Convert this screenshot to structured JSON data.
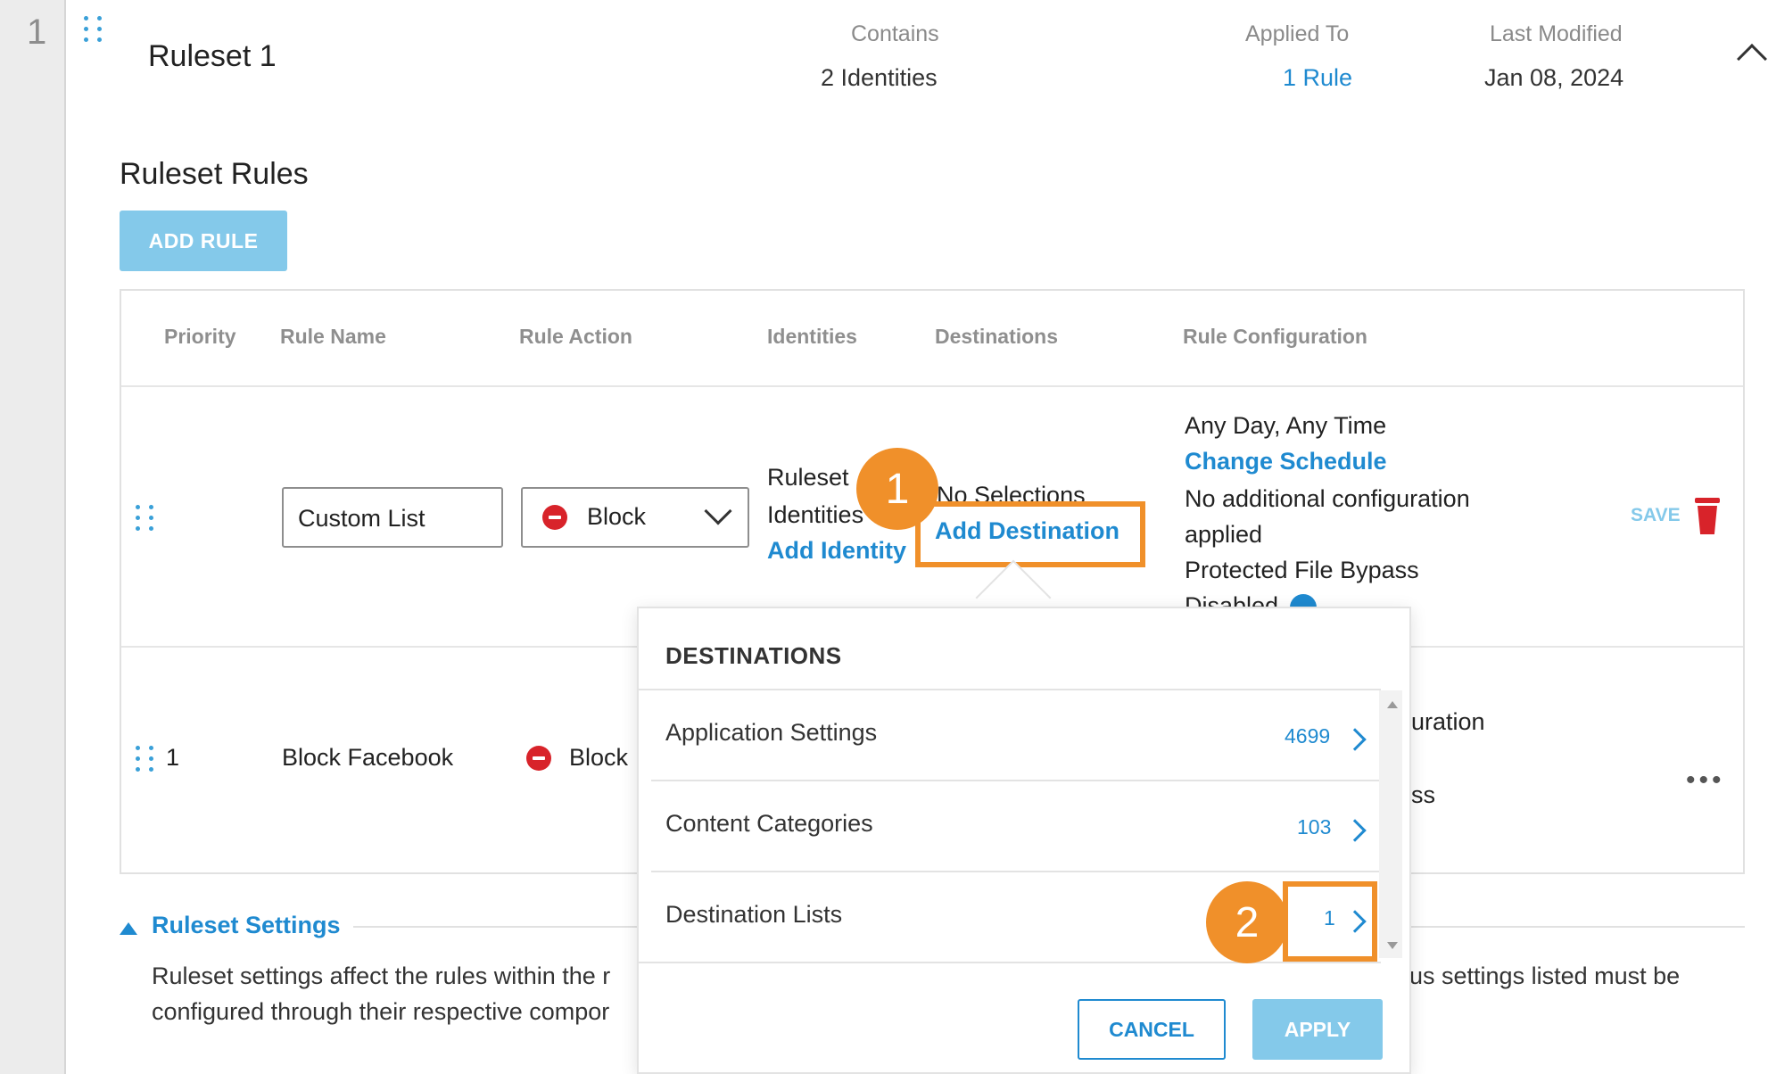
{
  "row_number": "1",
  "ruleset": {
    "title": "Ruleset 1",
    "contains_label": "Contains",
    "contains_value": "2 Identities",
    "applied_label": "Applied To",
    "applied_value": "1 Rule",
    "modified_label": "Last Modified",
    "modified_value": "Jan 08, 2024"
  },
  "rules_section": {
    "title": "Ruleset Rules",
    "add_button": "ADD RULE"
  },
  "table": {
    "headers": [
      "Priority",
      "Rule Name",
      "Rule Action",
      "Identities",
      "Destinations",
      "Rule Configuration"
    ],
    "edit_row": {
      "rule_name": "Custom List",
      "action": "Block",
      "identities_line1": "Ruleset",
      "identities_line2": "Identities",
      "add_identity": "Add Identity",
      "destinations_text": "No Selections",
      "add_destination": "Add Destination",
      "config_schedule": "Any Day, Any Time",
      "change_schedule": "Change Schedule",
      "config_line1": "No additional configuration",
      "config_line2": "applied",
      "config_line3": "Protected File Bypass",
      "config_line4": "Disabled",
      "save": "SAVE"
    },
    "row2": {
      "priority": "1",
      "rule_name": "Block Facebook",
      "action": "Block",
      "config_fragment1": "uration",
      "config_fragment2": "ss"
    }
  },
  "ruleset_settings": {
    "label": "Ruleset Settings",
    "text_line1_left": "Ruleset settings affect the rules within the r",
    "text_line2_left": "configured through their respective compor",
    "text_line1_right": "us settings listed must be"
  },
  "popover": {
    "title": "DESTINATIONS",
    "items": [
      {
        "label": "Application Settings",
        "count": "4699"
      },
      {
        "label": "Content Categories",
        "count": "103"
      },
      {
        "label": "Destination Lists",
        "count": "1"
      }
    ],
    "cancel": "CANCEL",
    "apply": "APPLY"
  },
  "callouts": [
    "1",
    "2"
  ],
  "colors": {
    "accent": "#1f8ad0",
    "button_disabled": "#84c9ea",
    "callout": "#f0902a",
    "block_red": "#d8232a"
  }
}
